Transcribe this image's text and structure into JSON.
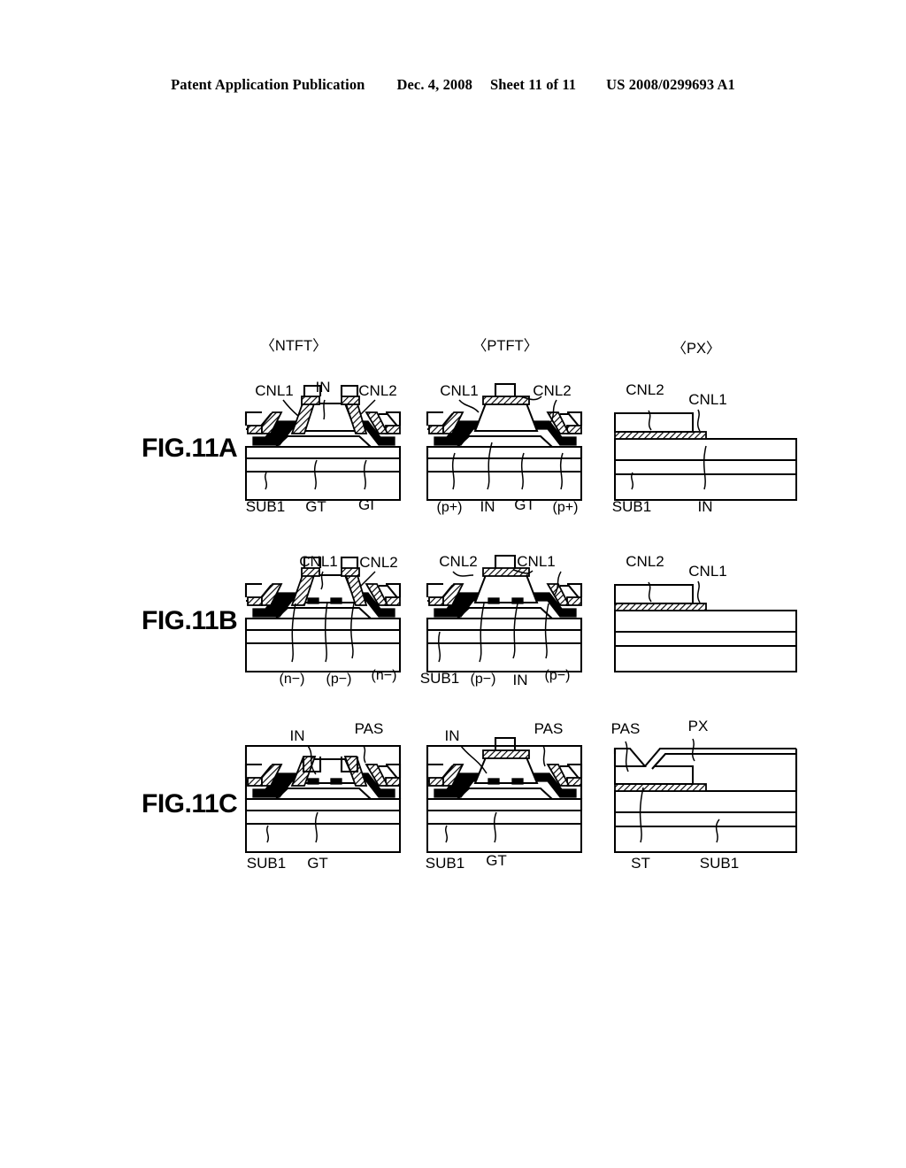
{
  "header": {
    "publication": "Patent Application Publication",
    "date": "Dec. 4, 2008",
    "sheet": "Sheet 11 of 11",
    "patent_number": "US 2008/0299693 A1"
  },
  "column_headers": [
    {
      "id": "ntft",
      "label": "〈NTFT〉"
    },
    {
      "id": "ptft",
      "label": "〈PTFT〉"
    },
    {
      "id": "px",
      "label": "〈PX〉"
    }
  ],
  "figures": [
    {
      "id": "fig-11a",
      "label": "FIG.11A",
      "panels": [
        {
          "id": "a-ntft",
          "top_labels": [
            "CNL1",
            "IN",
            "CNL2"
          ],
          "bottom_labels": [
            "SUB1",
            "GT",
            "GI"
          ]
        },
        {
          "id": "a-ptft",
          "top_labels": [
            "CNL1",
            "CNL2"
          ],
          "bottom_labels": [
            "(p+)",
            "IN",
            "GT",
            "(p+)"
          ]
        },
        {
          "id": "a-px",
          "top_labels": [
            "CNL2",
            "CNL1"
          ],
          "bottom_labels": [
            "SUB1",
            "IN"
          ]
        }
      ]
    },
    {
      "id": "fig-11b",
      "label": "FIG.11B",
      "panels": [
        {
          "id": "b-ntft",
          "top_labels": [
            "CNL1",
            "CNL2"
          ],
          "bottom_labels": [
            "(n−)",
            "(p−)",
            "(n−)"
          ]
        },
        {
          "id": "b-ptft",
          "top_labels": [
            "CNL2",
            "CNL1"
          ],
          "bottom_labels": [
            "SUB1",
            "(p−)",
            "IN",
            "(p−)"
          ]
        },
        {
          "id": "b-px",
          "top_labels": [
            "CNL2",
            "CNL1"
          ],
          "bottom_labels": []
        }
      ]
    },
    {
      "id": "fig-11c",
      "label": "FIG.11C",
      "panels": [
        {
          "id": "c-ntft",
          "top_labels": [
            "IN",
            "PAS"
          ],
          "bottom_labels": [
            "SUB1",
            "GT"
          ]
        },
        {
          "id": "c-ptft",
          "top_labels": [
            "IN",
            "PAS"
          ],
          "bottom_labels": [
            "SUB1",
            "GT"
          ]
        },
        {
          "id": "c-px",
          "top_labels": [
            "PAS",
            "PX"
          ],
          "bottom_labels": [
            "ST",
            "SUB1"
          ]
        }
      ]
    }
  ],
  "colors": {
    "ink": "#000000",
    "paper": "#ffffff"
  }
}
